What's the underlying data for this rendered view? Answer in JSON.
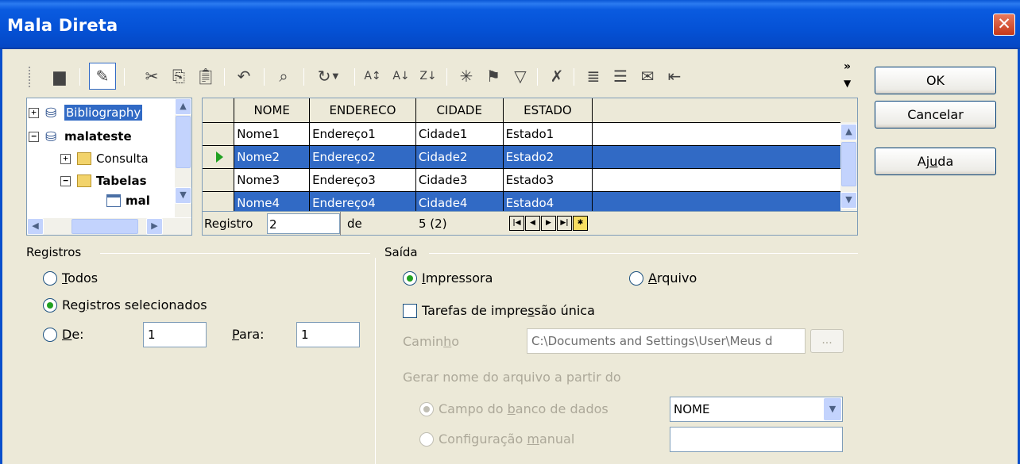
{
  "window": {
    "title": "Mala Direta",
    "close_label": "✕"
  },
  "toolbar": {
    "more_label": "»"
  },
  "tree": {
    "items": [
      {
        "label": "Bibliography"
      },
      {
        "label": "malateste"
      },
      {
        "label": "Consulta"
      },
      {
        "label": "Tabelas"
      },
      {
        "label": "mal"
      }
    ]
  },
  "grid": {
    "columns": [
      "NOME",
      "ENDERECO",
      "CIDADE",
      "ESTADO"
    ],
    "rows": [
      [
        "Nome1",
        "Endereço1",
        "Cidade1",
        "Estado1"
      ],
      [
        "Nome2",
        "Endereço2",
        "Cidade2",
        "Estado2"
      ],
      [
        "Nome3",
        "Endereço3",
        "Cidade3",
        "Estado3"
      ],
      [
        "Nome4",
        "Endereço4",
        "Cidade4",
        "Estado4"
      ]
    ],
    "nav": {
      "registro_label": "Registro",
      "registro_value": "2",
      "de_label": "de",
      "count": "5 (2)"
    }
  },
  "buttons": {
    "ok": "OK",
    "cancel": "Cancelar",
    "help_pre": "Aj",
    "help_u": "u",
    "help_post": "da"
  },
  "registros": {
    "title": "Registros",
    "todos_u": "T",
    "todos_rest": "odos",
    "sel_pre": "Re",
    "sel_u": "g",
    "sel_post": "istros selecionados",
    "de_u": "D",
    "de_rest": "e:",
    "de_value": "1",
    "para_u": "P",
    "para_rest": "ara:",
    "para_value": "1"
  },
  "saida": {
    "title": "Saída",
    "impressora_u": "I",
    "impressora_rest": "mpressora",
    "arquivo_u": "A",
    "arquivo_rest": "rquivo",
    "tarefas_pre": "Tarefas de impre",
    "tarefas_u": "s",
    "tarefas_post": "são única",
    "caminho_pre": "Camin",
    "caminho_u": "h",
    "caminho_post": "o",
    "caminho_value": "C:\\Documents and Settings\\User\\Meus d",
    "browse_label": "...",
    "gerar_label": "Gerar nome do arquivo a partir do",
    "campo_pre": "Campo do ",
    "campo_u": "b",
    "campo_post": "anco de dados",
    "campo_value": "NOME",
    "manual_pre": "Configuração ",
    "manual_u": "m",
    "manual_post": "anual",
    "manual_value": ""
  }
}
